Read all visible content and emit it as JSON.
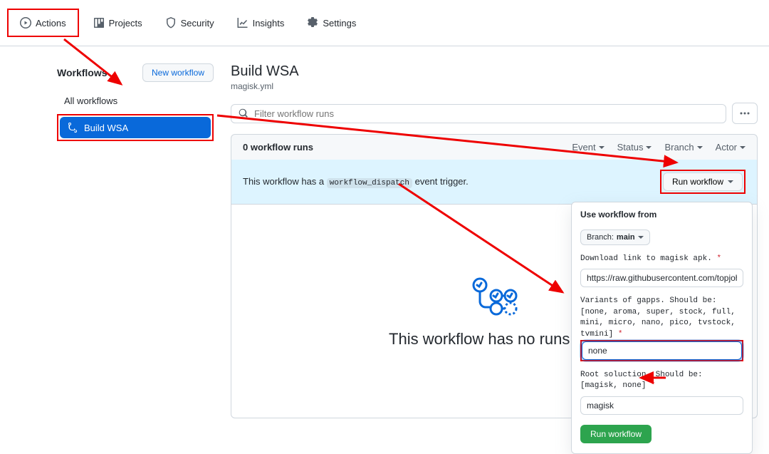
{
  "nav": {
    "actions": "Actions",
    "projects": "Projects",
    "security": "Security",
    "insights": "Insights",
    "settings": "Settings"
  },
  "sidebar": {
    "title": "Workflows",
    "new_btn": "New workflow",
    "all": "All workflows",
    "active_name": "Build WSA"
  },
  "main": {
    "title": "Build WSA",
    "file": "magisk.yml",
    "filter_placeholder": "Filter workflow runs",
    "runs_count": "0 workflow runs",
    "filters": {
      "event": "Event",
      "status": "Status",
      "branch": "Branch",
      "actor": "Actor"
    },
    "banner_pre": "This workflow has a ",
    "banner_code": "workflow_dispatch",
    "banner_post": " event trigger.",
    "run_btn": "Run workflow",
    "empty_text": "This workflow has no runs yet."
  },
  "panel": {
    "use_from": "Use workflow from",
    "branch_label": "Branch: ",
    "branch_value": "main",
    "f1_label": "Download link to magisk apk.",
    "f1_value": "https://raw.githubusercontent.com/topjohnwu/m",
    "f2_label": "Variants of gapps. Should be: [none, aroma, super, stock, full, mini, micro, nano, pico, tvstock, tvmini]",
    "f2_value": "none",
    "f3_label": "Root soluction. Should be: [magisk, none]",
    "f3_value": "magisk",
    "submit": "Run workflow"
  }
}
